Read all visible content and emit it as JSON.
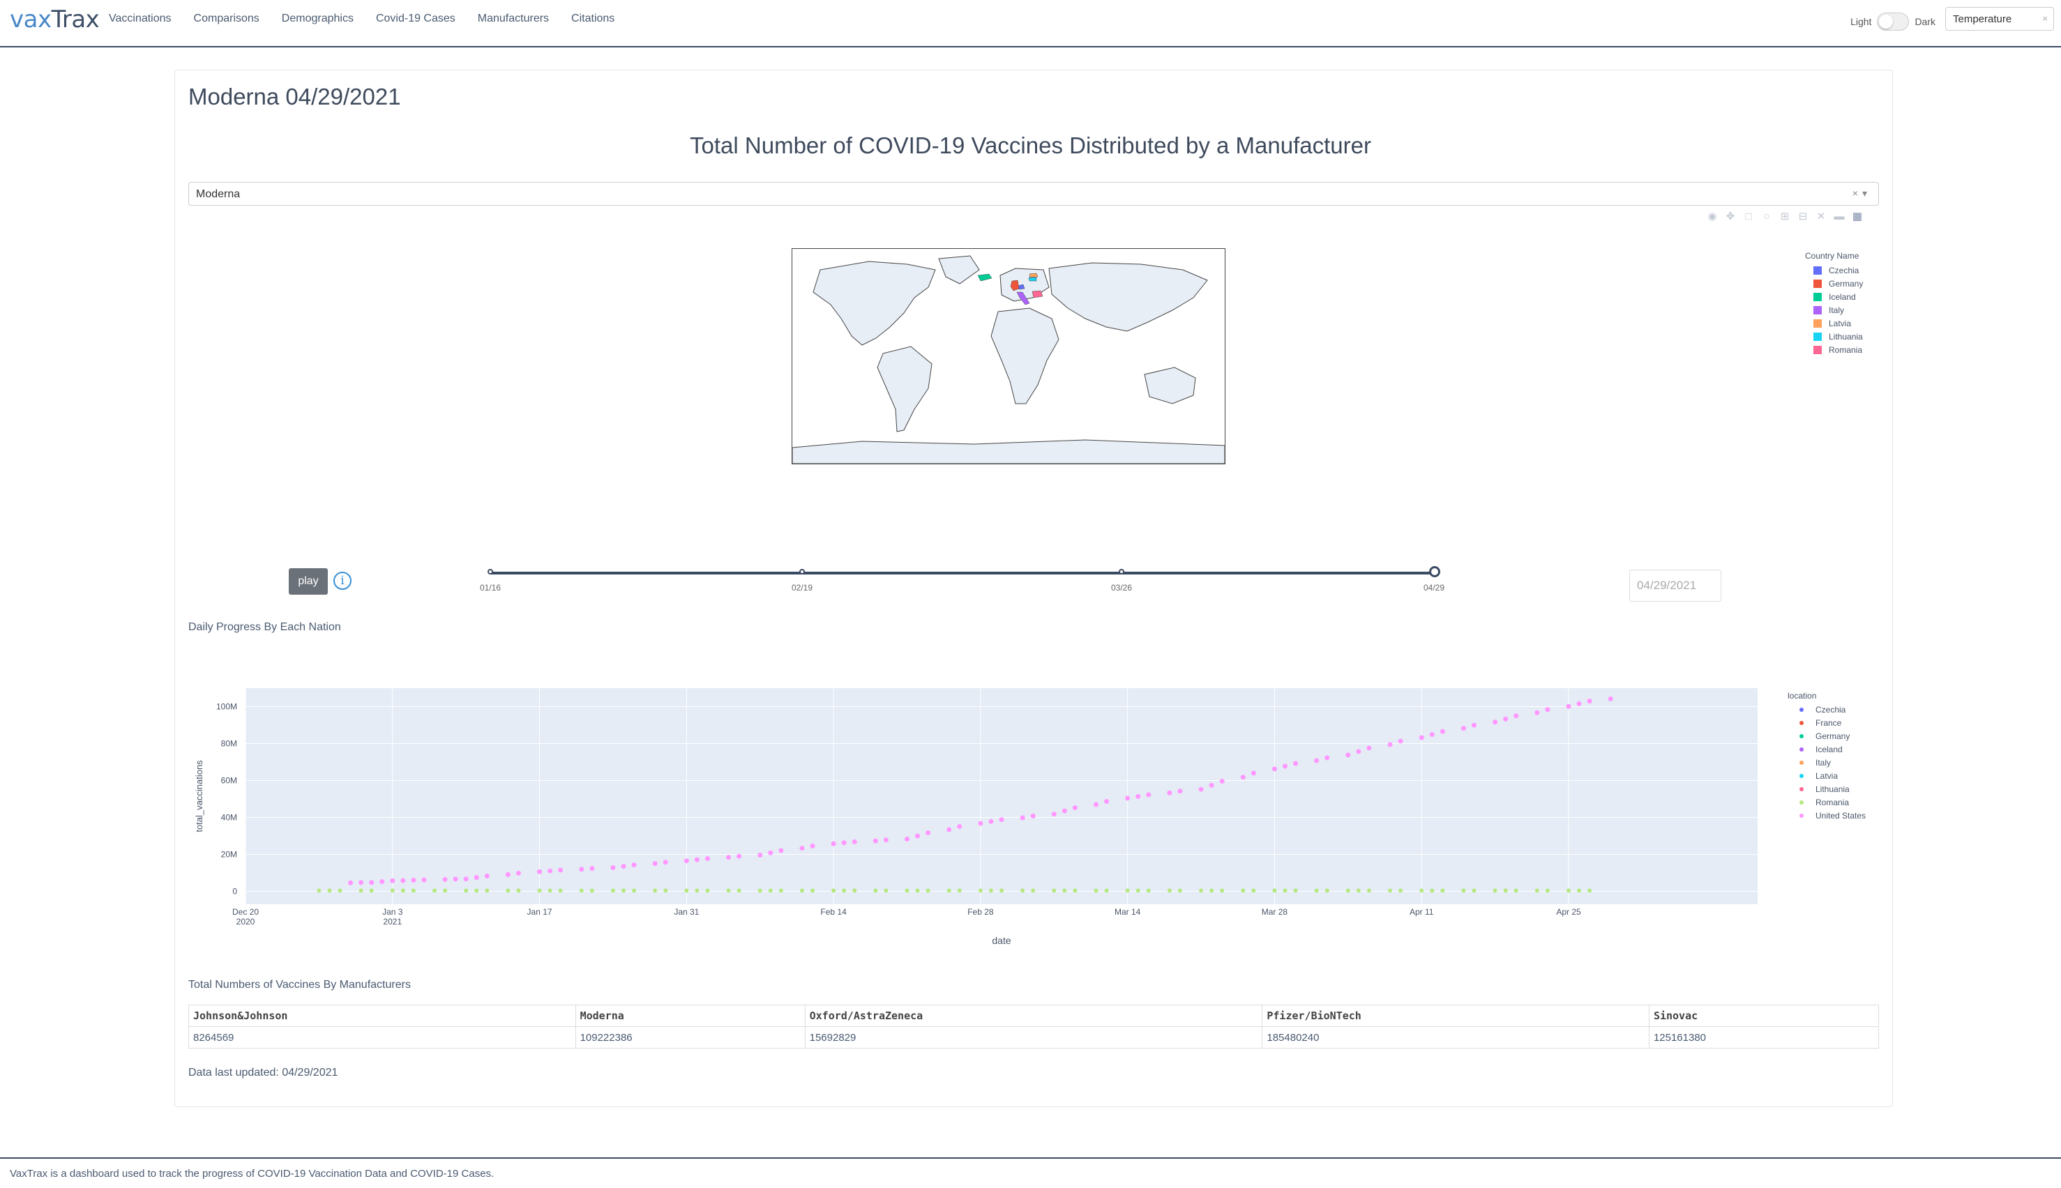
{
  "brand": {
    "part1": "vax",
    "part2": "Trax"
  },
  "nav": [
    "Vaccinations",
    "Comparisons",
    "Demographics",
    "Covid-19 Cases",
    "Manufacturers",
    "Citations"
  ],
  "theme": {
    "light_label": "Light",
    "dark_label": "Dark"
  },
  "metric_select": {
    "value": "Temperature",
    "clear": "×"
  },
  "card_title": "Moderna 04/29/2021",
  "main_title": "Total Number of COVID-19 Vaccines Distributed by a Manufacturer",
  "manufacturer_dropdown": {
    "value": "Moderna",
    "controls": "×▾"
  },
  "map_legend": {
    "title": "Country Name",
    "items": [
      {
        "label": "Czechia",
        "color": "#636efa"
      },
      {
        "label": "Germany",
        "color": "#ef553b"
      },
      {
        "label": "Iceland",
        "color": "#00cc96"
      },
      {
        "label": "Italy",
        "color": "#ab63fa"
      },
      {
        "label": "Latvia",
        "color": "#ffa15a"
      },
      {
        "label": "Lithuania",
        "color": "#19d3f3"
      },
      {
        "label": "Romania",
        "color": "#ff6692"
      }
    ]
  },
  "player": {
    "play_label": "play",
    "info_icon": "info-icon",
    "date_value": "04/29/2021"
  },
  "slider": {
    "ticks": [
      "01/16",
      "02/19",
      "03/26",
      "04/29"
    ],
    "value": "04/29"
  },
  "daily_progress_label": "Daily Progress By Each Nation",
  "chart_data": {
    "type": "scatter",
    "xlabel": "date",
    "ylabel": "total_vaccinations",
    "ylim": [
      -7000000,
      110000000
    ],
    "x_ticks": [
      "Dec 20\n2020",
      "Jan 3\n2021",
      "Jan 17",
      "Jan 31",
      "Feb 14",
      "Feb 28",
      "Mar 14",
      "Mar 28",
      "Apr 11",
      "Apr 25"
    ],
    "y_ticks": [
      "0",
      "20M",
      "40M",
      "60M",
      "80M",
      "100M"
    ],
    "y_tick_values": [
      0,
      20000000,
      40000000,
      60000000,
      80000000,
      100000000
    ],
    "legend_title": "location",
    "series": [
      {
        "name": "Czechia",
        "color": "#636efa"
      },
      {
        "name": "France",
        "color": "#ef553b"
      },
      {
        "name": "Germany",
        "color": "#00cc96"
      },
      {
        "name": "Iceland",
        "color": "#ab63fa"
      },
      {
        "name": "Italy",
        "color": "#ffa15a"
      },
      {
        "name": "Latvia",
        "color": "#19d3f3"
      },
      {
        "name": "Lithuania",
        "color": "#ff6692"
      },
      {
        "name": "Romania",
        "color": "#b6e880"
      },
      {
        "name": "United States",
        "color": "#ff97ff",
        "points": [
          [
            "2020-12-30",
            4.6
          ],
          [
            "2021-01-01",
            4.8
          ],
          [
            "2021-01-04",
            5.8
          ],
          [
            "2021-01-10",
            6.7
          ],
          [
            "2021-01-17",
            10.6
          ],
          [
            "2021-01-24",
            12.8
          ],
          [
            "2021-01-31",
            16.5
          ],
          [
            "2021-02-07",
            19.6
          ],
          [
            "2021-02-14",
            25.8
          ],
          [
            "2021-02-21",
            28.3
          ],
          [
            "2021-02-28",
            36.8
          ],
          [
            "2021-03-07",
            41.8
          ],
          [
            "2021-03-14",
            50.4
          ],
          [
            "2021-03-21",
            55.2
          ],
          [
            "2021-03-28",
            66.2
          ],
          [
            "2021-04-04",
            73.8
          ],
          [
            "2021-04-11",
            83.2
          ],
          [
            "2021-04-18",
            91.6
          ],
          [
            "2021-04-25",
            100.1
          ],
          [
            "2021-04-29",
            104.2
          ]
        ]
      }
    ],
    "y_units": "millions"
  },
  "manufacturers_label": "Total Numbers of Vaccines By Manufacturers",
  "manufacturers_table": {
    "headers": [
      "Johnson&Johnson",
      "Moderna",
      "Oxford/AstraZeneca",
      "Pfizer/BioNTech",
      "Sinovac"
    ],
    "values": [
      "8264569",
      "109222386",
      "15692829",
      "185480240",
      "125161380"
    ]
  },
  "updated": "Data last updated: 04/29/2021",
  "footer": "VaxTrax is a dashboard used to track the progress of COVID-19 Vaccination Data and COVID-19 Cases."
}
